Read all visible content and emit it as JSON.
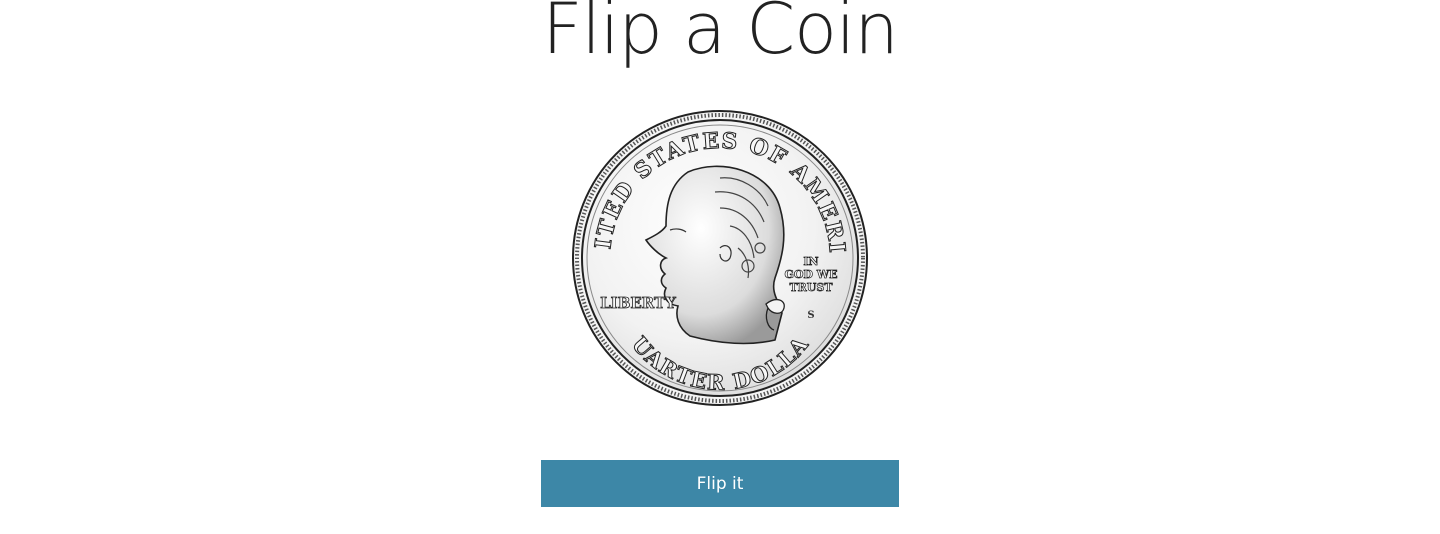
{
  "page": {
    "title": "Flip a Coin"
  },
  "coin": {
    "icon": "quarter-dollar-coin-icon",
    "side": "heads",
    "legend_top": "UNITED STATES OF AMERICA",
    "legend_bottom": "QUARTER DOLLAR",
    "motto_line1": "IN",
    "motto_line2": "GOD WE",
    "motto_line3": "TRUST",
    "liberty": "LIBERTY",
    "mint_mark": "S"
  },
  "actions": {
    "flip_label": "Flip it"
  },
  "colors": {
    "button_background": "#3d87a7",
    "button_text": "#ffffff",
    "title_text": "#222222"
  }
}
